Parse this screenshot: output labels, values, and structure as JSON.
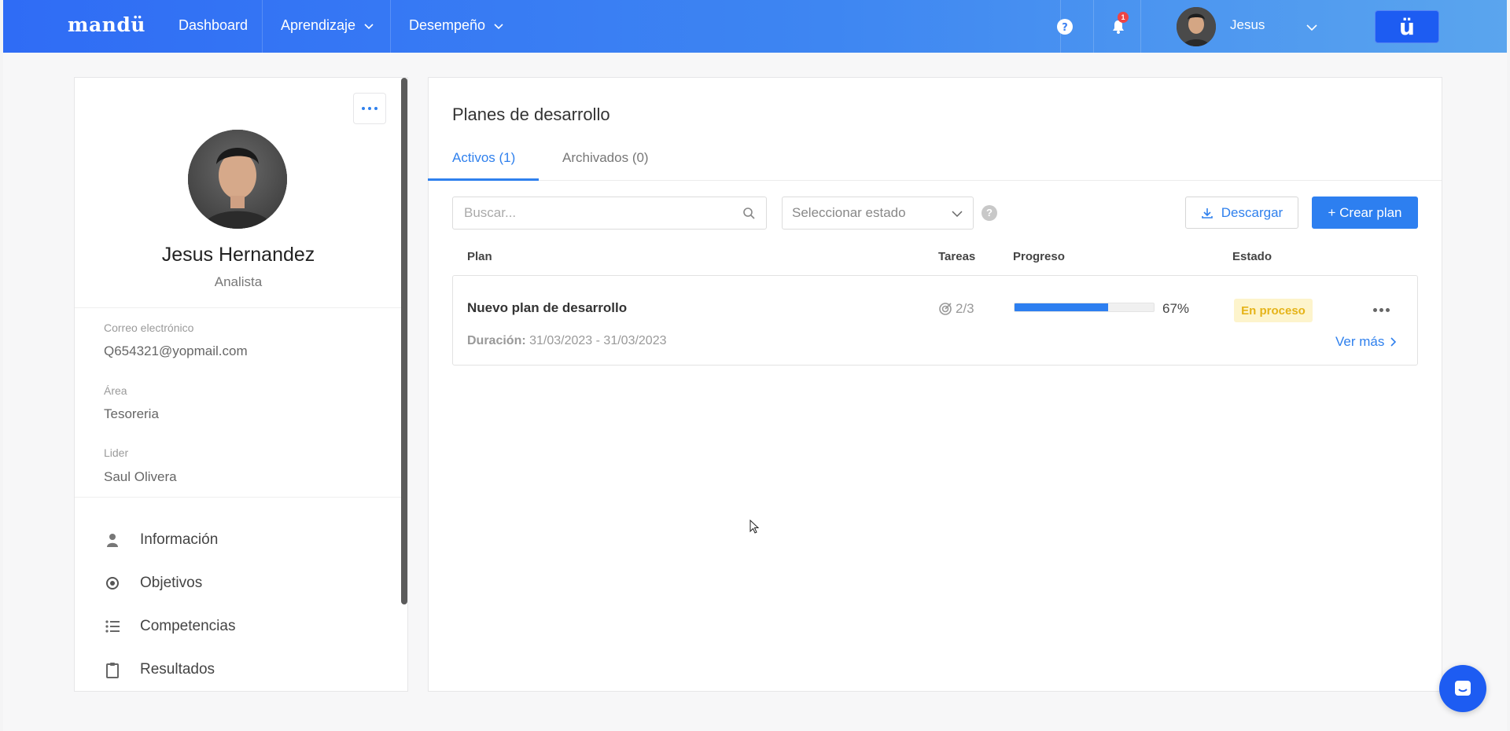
{
  "topbar": {
    "logo": "mandü",
    "nav": [
      {
        "label": "Dashboard"
      },
      {
        "label": "Aprendizaje"
      },
      {
        "label": "Desempeño"
      }
    ],
    "notifications_count": "1",
    "user_name": "Jesus",
    "brand_button": "ü"
  },
  "profile": {
    "name": "Jesus Hernandez",
    "role": "Analista",
    "fields": [
      {
        "label": "Correo electrónico",
        "value": "Q654321@yopmail.com"
      },
      {
        "label": "Área",
        "value": "Tesoreria"
      },
      {
        "label": "Lider",
        "value": "Saul Olivera"
      }
    ],
    "menu": [
      {
        "label": "Información",
        "icon": "user-icon"
      },
      {
        "label": "Objetivos",
        "icon": "target-icon"
      },
      {
        "label": "Competencias",
        "icon": "list-icon"
      },
      {
        "label": "Resultados",
        "icon": "clipboard-icon"
      }
    ]
  },
  "main": {
    "title": "Planes de desarrollo",
    "tabs": [
      {
        "label": "Activos (1)",
        "active": true
      },
      {
        "label": "Archivados (0)",
        "active": false
      }
    ],
    "search": {
      "placeholder": "Buscar..."
    },
    "status_select": {
      "placeholder": "Seleccionar estado"
    },
    "download_label": "Descargar",
    "create_label": "+ Crear plan",
    "columns": [
      "Plan",
      "Tareas",
      "Progreso",
      "Estado"
    ],
    "rows": [
      {
        "title": "Nuevo plan de desarrollo",
        "duration_label": "Duración:",
        "duration_value": "31/03/2023 - 31/03/2023",
        "tasks": "2/3",
        "progress_percent": 67,
        "progress_label": "67%",
        "status": "En proceso",
        "more_label": "Ver más"
      }
    ]
  },
  "colors": {
    "accent": "#2f80ed",
    "status_in_progress_bg": "#fdf4cc",
    "status_in_progress_text": "#e5b318"
  }
}
